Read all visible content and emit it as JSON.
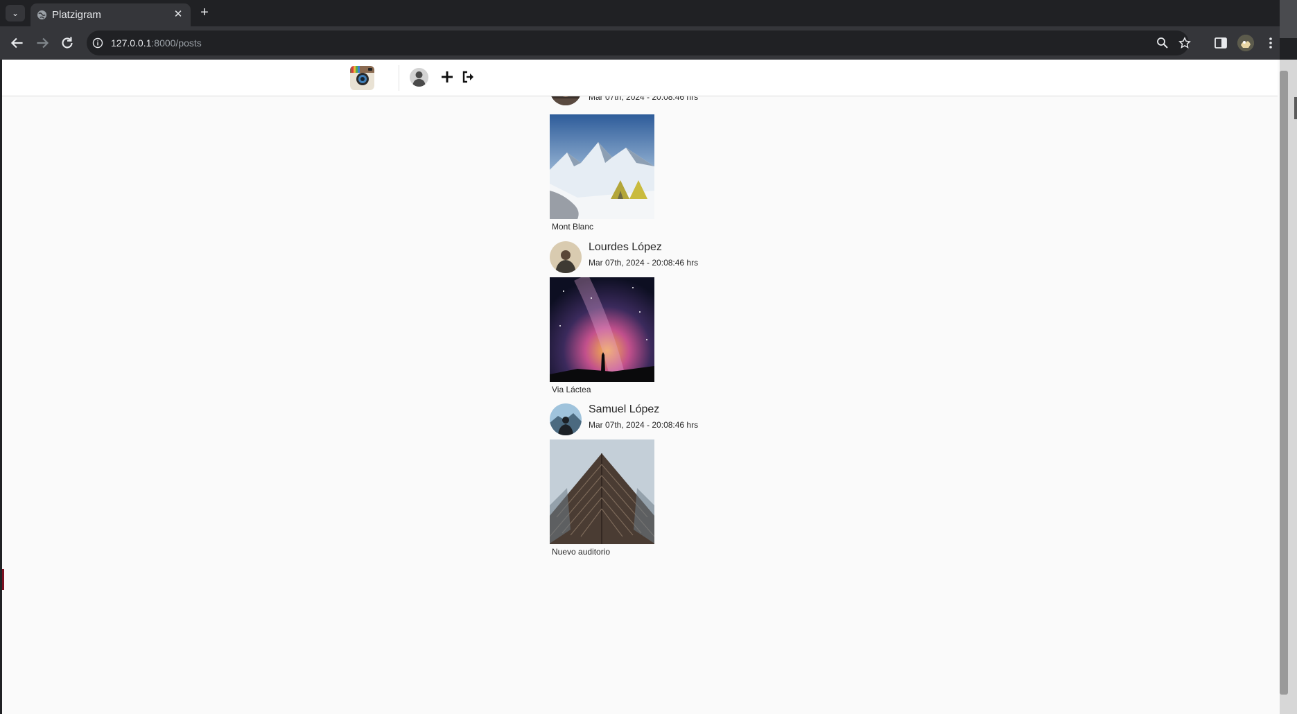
{
  "browser": {
    "tab_title": "Platzigram",
    "url_host": "127.0.0.1",
    "url_path": ":8000/posts"
  },
  "app": {
    "brand_icon": "instagram-camera-logo",
    "nav_icons": [
      "profile-avatar-icon",
      "plus-icon",
      "sign-out-icon"
    ]
  },
  "posts": [
    {
      "author": "",
      "date": "Mar 07th, 2024 - 20:08:46 hrs",
      "caption": "Mont Blanc",
      "photo": "snowy-mountain-tents"
    },
    {
      "author": "Lourdes López",
      "date": "Mar 07th, 2024 - 20:08:46 hrs",
      "caption": "Via Láctea",
      "photo": "milky-way-silhouette"
    },
    {
      "author": "Samuel López",
      "date": "Mar 07th, 2024 - 20:08:46 hrs",
      "caption": "Nuevo auditorio",
      "photo": "triangular-building"
    }
  ]
}
